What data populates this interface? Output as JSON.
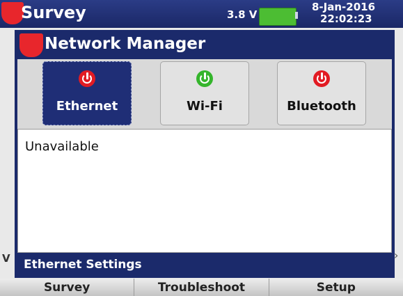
{
  "app": {
    "title": "Survey",
    "voltage": "3.8 V",
    "date": "8-Jan-2016",
    "time": "22:02:23",
    "partial_left_label": "V"
  },
  "dialog": {
    "title": "Network Manager",
    "tabs": [
      {
        "label": "Ethernet",
        "icon": "power-icon",
        "status_color": "#e21b23",
        "selected": true
      },
      {
        "label": "Wi-Fi",
        "icon": "power-icon",
        "status_color": "#35b52c",
        "selected": false
      },
      {
        "label": "Bluetooth",
        "icon": "power-icon",
        "status_color": "#e21b23",
        "selected": false
      }
    ],
    "status_text": "Unavailable",
    "footer": "Ethernet Settings"
  },
  "softkeys": [
    "Survey",
    "Troubleshoot",
    "Setup"
  ],
  "colors": {
    "brand_red": "#e8262c",
    "header_navy": "#1b2a6b",
    "battery_green": "#4cbd33"
  }
}
